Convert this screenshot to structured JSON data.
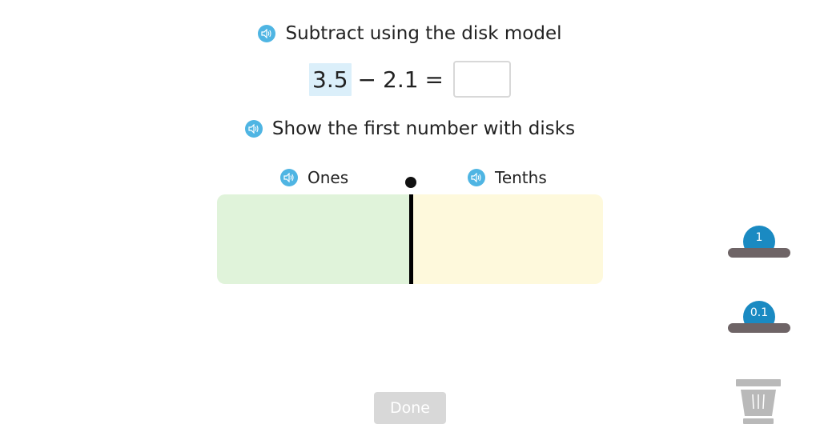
{
  "prompt": {
    "title": "Subtract using the disk model",
    "instruction": "Show the first number with disks"
  },
  "equation": {
    "first_number": "3.5",
    "operator": "−",
    "second_number": "2.1",
    "equals": "=",
    "answer_value": ""
  },
  "place_value_chart": {
    "left_column_label": "Ones",
    "right_column_label": "Tenths"
  },
  "disk_sources": {
    "ones_disk_label": "1",
    "tenths_disk_label": "0.1"
  },
  "done_button_label": "Done",
  "colors": {
    "speaker": "#4fb5e3",
    "highlight": "#dbeffa",
    "ones_column": "#e0f3da",
    "tenths_column": "#fef9dc",
    "disk": "#1a8ac2",
    "tray": "#6e6466",
    "done_disabled": "#d8d8d8",
    "trash": "#b9b9b9"
  },
  "icons": {
    "speaker": "speaker-icon",
    "trash": "trash-icon"
  }
}
